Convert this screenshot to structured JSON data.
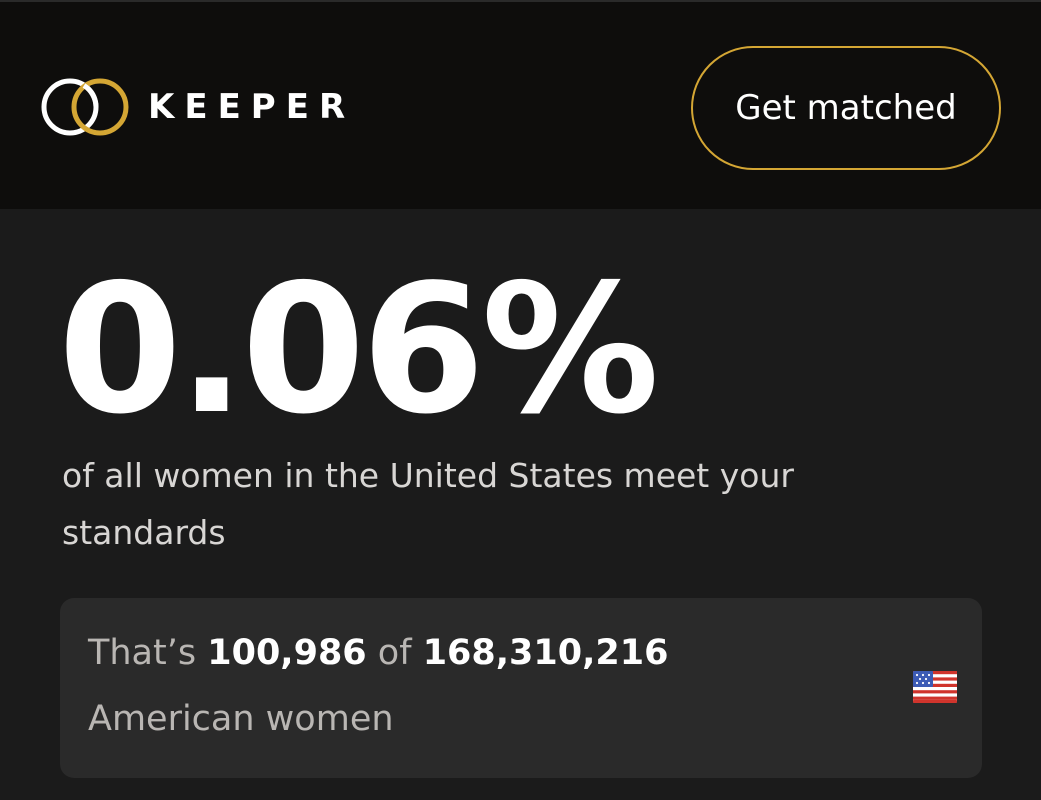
{
  "header": {
    "brand": "KEEPER",
    "cta_label": "Get matched",
    "logo_icon": "interlocking-rings-icon",
    "accent_color": "#d4a634"
  },
  "stat": {
    "percentage": "0.06%",
    "description": "of all women in the United States meet your standards"
  },
  "summary_card": {
    "prefix": "That’s",
    "matched_count": "100,986",
    "joiner": "of",
    "total_count": "168,310,216",
    "suffix": "American women",
    "flag_icon": "us-flag-icon"
  }
}
